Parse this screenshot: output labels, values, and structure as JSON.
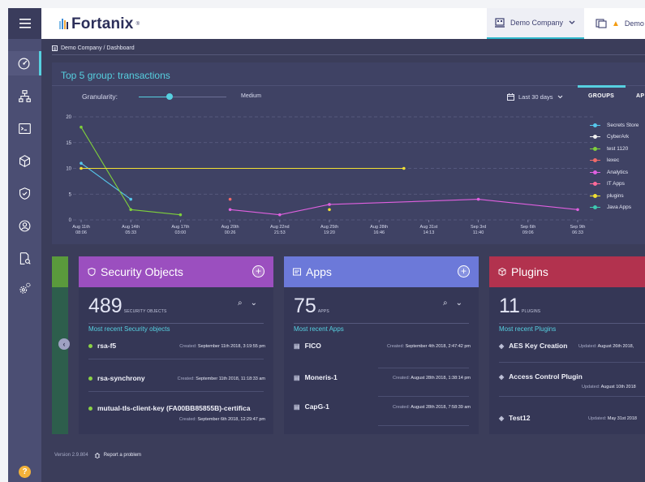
{
  "header": {
    "logo_text": "Fortanix",
    "logo_mark": "®",
    "account": "Demo Company",
    "right_label": "Demo"
  },
  "breadcrumb": "Demo Company / Dashboard",
  "chart_panel": {
    "title": "Top 5 group: transactions",
    "granularity_label": "Granularity:",
    "granularity_value": "Medium",
    "granularity_level": 0.35,
    "range_label": "Last 30 days",
    "tabs": [
      "GROUPS",
      "AP"
    ]
  },
  "chart_data": {
    "type": "line",
    "ylim": [
      0,
      20
    ],
    "yticks": [
      "20",
      "15",
      "10",
      "5",
      "0"
    ],
    "x_labels": [
      {
        "date": "Aug 11th",
        "time": "08:06"
      },
      {
        "date": "Aug 14th",
        "time": "05:33"
      },
      {
        "date": "Aug 17th",
        "time": "03:00"
      },
      {
        "date": "Aug 20th",
        "time": "00:26"
      },
      {
        "date": "Aug 22nd",
        "time": "21:53"
      },
      {
        "date": "Aug 25th",
        "time": "19:20"
      },
      {
        "date": "Aug 28th",
        "time": "16:46"
      },
      {
        "date": "Aug 31st",
        "time": "14:13"
      },
      {
        "date": "Sep 3rd",
        "time": "11:40"
      },
      {
        "date": "Sep 6th",
        "time": "09:06"
      },
      {
        "date": "Sep 9th",
        "time": "06:33"
      }
    ],
    "series": [
      {
        "name": "Secrets Store",
        "color": "#56c8ec",
        "points": [
          [
            0,
            11
          ],
          [
            1,
            4
          ]
        ]
      },
      {
        "name": "CyberArk",
        "color": "#f0f0f0",
        "points": []
      },
      {
        "name": "test 1120",
        "color": "#7fd13b",
        "points": [
          [
            0,
            18
          ],
          [
            1,
            2
          ],
          [
            2,
            1
          ]
        ]
      },
      {
        "name": "lexec",
        "color": "#f06a6a",
        "points": [
          [
            3,
            4
          ]
        ]
      },
      {
        "name": "Analytics",
        "color": "#e060e0",
        "points": [
          [
            3,
            2
          ],
          [
            4,
            1
          ],
          [
            5,
            3
          ],
          [
            8,
            4
          ],
          [
            10,
            2
          ]
        ]
      },
      {
        "name": "IT Apps",
        "color": "#ff6a9a",
        "points": []
      },
      {
        "name": "plugins",
        "color": "#f2e033",
        "points": [
          [
            0,
            10
          ],
          [
            6.5,
            10
          ]
        ],
        "dot": [
          5,
          2
        ]
      },
      {
        "name": "Java Apps",
        "color": "#3ec9b0",
        "points": []
      }
    ]
  },
  "cards": {
    "security": {
      "title": "Security Objects",
      "count": "489",
      "unit": "SECURITY OBJECTS",
      "recent_label": "Most recent Security objects",
      "color": "#9b4fbf",
      "items": [
        {
          "name": "rsa-f5",
          "meta_label": "Created:",
          "meta": "September 11th 2018, 3:19:55 pm"
        },
        {
          "name": "rsa-synchrony",
          "meta_label": "Created:",
          "meta": "September 11th 2018, 11:18:33 am"
        },
        {
          "name": "mutual-tls-client-key (FA00BB85855B)-certifica",
          "meta_label": "Created:",
          "meta": "September 6th 2018, 12:29:47 pm"
        }
      ]
    },
    "apps": {
      "title": "Apps",
      "count": "75",
      "unit": "APPS",
      "recent_label": "Most recent Apps",
      "color": "#6c79d9",
      "items": [
        {
          "name": "FICO",
          "meta_label": "Created:",
          "meta": "September 4th 2018, 2:47:42 pm"
        },
        {
          "name": "Moneris-1",
          "meta_label": "Created:",
          "meta": "August 28th 2018, 1:38:14 pm"
        },
        {
          "name": "CapG-1",
          "meta_label": "Created:",
          "meta": "August 28th 2018, 7:58:39 am"
        }
      ]
    },
    "plugins": {
      "title": "Plugins",
      "count": "11",
      "unit": "PLUGINS",
      "recent_label": "Most recent Plugins",
      "color": "#b2324e",
      "items": [
        {
          "name": "AES Key Creation",
          "meta_label": "Updated:",
          "meta": "August 26th 2018,"
        },
        {
          "name": "Access Control Plugin",
          "meta_label": "Updated:",
          "meta": "August 10th 2018"
        },
        {
          "name": "Test12",
          "meta_label": "Updated:",
          "meta": "May 31st 2018"
        }
      ]
    }
  },
  "footer": {
    "version": "Version 2.9.804",
    "report": "Report a problem"
  }
}
